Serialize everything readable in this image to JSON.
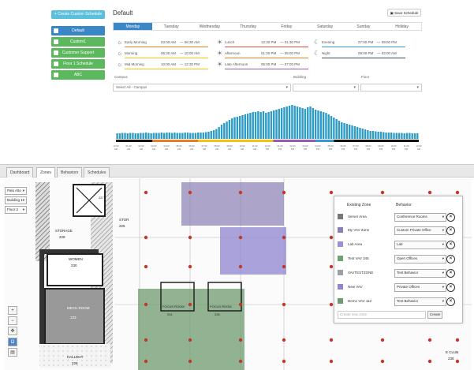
{
  "schedule": {
    "create_label": "+ Create Custom Schedule",
    "title": "Default",
    "save_label": "Save Schedule",
    "list": [
      {
        "label": "Default",
        "active": true
      },
      {
        "label": "Custom1",
        "active": false
      },
      {
        "label": "Customer Support",
        "active": false
      },
      {
        "label": "Floor 1 Schedule",
        "active": false
      },
      {
        "label": "ABC",
        "active": false
      }
    ],
    "days": [
      "Monday",
      "Tuesday",
      "Wednesday",
      "Thursday",
      "Friday",
      "Saturday",
      "Sunday",
      "Holiday"
    ],
    "active_day": "Monday",
    "periods": [
      {
        "icon": "early-morning-icon",
        "glyph": "☼",
        "name": "Early Morning",
        "start": "03:00 AM",
        "end": "— 06:30 AM",
        "color": "#e67e22"
      },
      {
        "icon": "morning-icon",
        "glyph": "☼",
        "name": "Morning",
        "start": "06:30 AM",
        "end": "— 10:00 AM",
        "color": "#f1c40f"
      },
      {
        "icon": "mid-morning-icon",
        "glyph": "☼",
        "name": "Mid Morning",
        "start": "10:00 AM",
        "end": "— 12:30 PM",
        "color": "#f1c40f"
      },
      {
        "icon": "lunch-icon",
        "glyph": "☀",
        "name": "Lunch",
        "start": "12:30 PM",
        "end": "— 01:30 PM",
        "color": "#e74c3c"
      },
      {
        "icon": "afternoon-icon",
        "glyph": "☀",
        "name": "Afternoon",
        "start": "01:30 PM",
        "end": "— 05:00 PM",
        "color": "#e67e22"
      },
      {
        "icon": "late-afternoon-icon",
        "glyph": "☀",
        "name": "Late Afternoon",
        "start": "05:00 PM",
        "end": "— 07:00 PM",
        "color": "#9b59b6"
      },
      {
        "icon": "evening-icon",
        "glyph": "☾",
        "name": "Evening",
        "start": "07:00 PM",
        "end": "— 09:00 PM",
        "color": "#3498db"
      },
      {
        "icon": "night-icon",
        "glyph": "☾",
        "name": "Night",
        "start": "09:00 PM",
        "end": "— 03:00 AM",
        "color": "#34495e"
      }
    ],
    "filters": {
      "campus_label": "Campus",
      "building_label": "Building",
      "floor_label": "Floor",
      "campus_value": "Select All - Campus"
    }
  },
  "chart_data": {
    "type": "bar",
    "title": "",
    "xlabel": "",
    "ylabel": "",
    "ylim": [
      0,
      100
    ],
    "x_tick_labels": [
      "12:00 AM",
      "01:00 AM",
      "02:00 AM",
      "03:00 AM",
      "04:00 AM",
      "05:00 AM",
      "06:00 AM",
      "07:00 AM",
      "08:00 AM",
      "09:00 AM",
      "10:00 AM",
      "11:00 AM",
      "12:00 PM",
      "01:00 PM",
      "02:00 PM",
      "03:00 PM",
      "04:00 PM",
      "05:00 PM",
      "06:00 PM",
      "07:00 PM",
      "08:00 PM",
      "09:00 PM",
      "10:00 PM",
      "11:00 PM",
      "12:00 AM"
    ],
    "values": [
      14,
      14,
      15,
      15,
      14,
      15,
      15,
      14,
      14,
      15,
      15,
      16,
      15,
      14,
      15,
      15,
      15,
      16,
      15,
      16,
      16,
      15,
      16,
      15,
      15,
      15,
      16,
      16,
      15,
      15,
      15,
      16,
      16,
      16,
      17,
      18,
      20,
      22,
      25,
      30,
      36,
      40,
      44,
      48,
      52,
      55,
      56,
      58,
      60,
      62,
      64,
      66,
      68,
      68,
      70,
      68,
      70,
      66,
      68,
      70,
      72,
      74,
      76,
      78,
      80,
      82,
      84,
      86,
      84,
      82,
      80,
      78,
      76,
      80,
      82,
      78,
      74,
      72,
      70,
      68,
      66,
      62,
      58,
      54,
      50,
      46,
      42,
      40,
      38,
      36,
      34,
      32,
      30,
      28,
      26,
      24,
      22,
      20,
      20,
      19,
      18,
      18,
      17,
      16,
      16,
      16,
      15,
      15,
      15,
      15,
      14,
      15,
      15,
      14,
      14,
      14
    ],
    "color": "#2e9bc4",
    "timeline_colors": [
      "#e67e22",
      "#f1c40f",
      "#9b59b6",
      "#3498db"
    ]
  },
  "floorplan": {
    "tabs": [
      "Dashboard",
      "Zones",
      "Behaviors",
      "Schedules"
    ],
    "active_tab": "Zones",
    "campus": "Palo Alto",
    "building": "Building 1",
    "floor": "Floor 2",
    "room_labels": [
      "STOR",
      "STORAGE",
      "WOMEN",
      "MECH ROOM",
      "FOCUS ROOM",
      "FOCUS ROOM",
      "HALLWAY",
      "E CLUB"
    ],
    "room_numbers": [
      "225",
      "228",
      "230",
      "233",
      "231",
      "226",
      "226",
      "227",
      "236"
    ],
    "tools": [
      "+",
      "−",
      "✥",
      "Ω",
      "▤"
    ],
    "zone_panel": {
      "header_zone": "Existing Zone",
      "header_behavior": "Behavior",
      "zones": [
        {
          "name": "Server Area",
          "color": "#777777",
          "behavior": "Conference Rooms"
        },
        {
          "name": "My VAV Zone",
          "color": "#8c7fb4",
          "behavior": "Custom Private Office"
        },
        {
          "name": "Lab Area",
          "color": "#9b8fd8",
          "behavior": "Lab"
        },
        {
          "name": "Test VAV 345",
          "color": "#6fa36f",
          "behavior": "Open Offices"
        },
        {
          "name": "VAVTESTZONE",
          "color": "#9aa0a8",
          "behavior": "Test Behavior"
        },
        {
          "name": "New VAV",
          "color": "#8f86d0",
          "behavior": "Private Offices"
        },
        {
          "name": "Demo VAV 112",
          "color": "#6e9b6e",
          "behavior": "Test Behavior"
        }
      ],
      "new_zone_placeholder": "Create new zone",
      "create_label": "Create"
    }
  }
}
